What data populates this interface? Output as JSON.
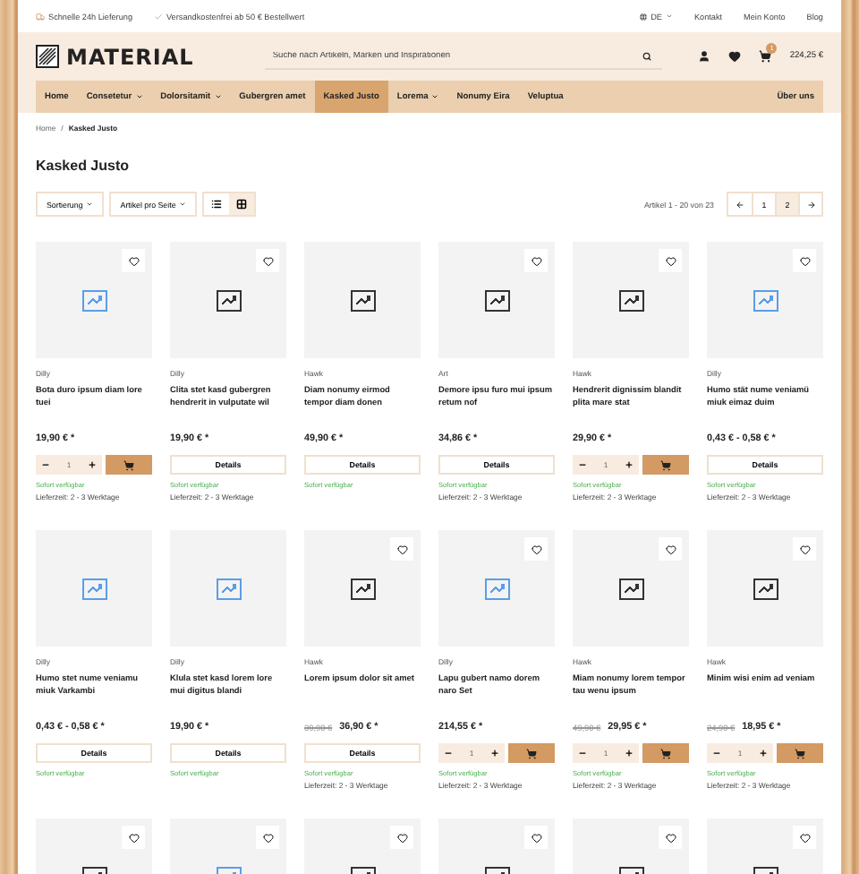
{
  "top_bar": {
    "features": [
      {
        "kind": "truck",
        "text": "Schnelle 24h Lieferung"
      },
      {
        "kind": "check",
        "text": "Versandkostenfrei ab 50 € Bestellwert"
      }
    ],
    "language": "DE",
    "links": [
      "Kontakt",
      "Mein Konto",
      "Blog"
    ]
  },
  "header": {
    "logo": "MATERIAL",
    "search": {
      "placeholder": "Suche nach Artikeln, Marken und Inspirationen"
    },
    "cart": {
      "count": "1",
      "total": "224,25 €"
    }
  },
  "nav": [
    {
      "label": "Home",
      "dropdown": false,
      "selected": false
    },
    {
      "label": "Consetetur",
      "dropdown": true,
      "selected": false
    },
    {
      "label": "Dolorsitamit",
      "dropdown": true,
      "selected": false
    },
    {
      "label": "Gubergren amet",
      "dropdown": false,
      "selected": false
    },
    {
      "label": "Kasked Justo",
      "dropdown": false,
      "selected": true
    },
    {
      "label": "Lorema",
      "dropdown": true,
      "selected": false
    },
    {
      "label": "Nonumy Eira",
      "dropdown": false,
      "selected": false
    },
    {
      "label": "Veluptua",
      "dropdown": false,
      "selected": false
    }
  ],
  "nav_right": "Über uns",
  "breadcrumb": [
    "Home",
    "Kasked Justo"
  ],
  "breadcrumb_separator": "/",
  "title": "Kasked Justo",
  "toolbar": {
    "sort": "Sortierung",
    "per_page": "Artikel pro Seite",
    "views": [
      {
        "kind": "list",
        "selected": false
      },
      {
        "kind": "grid",
        "selected": true
      }
    ],
    "count": "Artikel 1 - 20 von 23",
    "pages": [
      {
        "label": "1",
        "selected": false
      },
      {
        "label": "2",
        "selected": true
      }
    ]
  },
  "products": [
    {
      "color": "#5a9ee8",
      "wishlist": true,
      "brand": "Dilly",
      "name": "Bota duro ipsum diam lore tuei",
      "price": "19,90 € *",
      "kind": "cart",
      "quantity": "1",
      "availability": "Sofort verfügbar",
      "delivery": "Lieferzeit: 2 - 3 Werktage"
    },
    {
      "color": "#333333",
      "wishlist": true,
      "brand": "Dilly",
      "name": "Clita stet kasd gubergren hendrerit in vulputate wil",
      "price": "19,90 € *",
      "kind": "details",
      "button": "Details",
      "availability": "Sofort verfügbar",
      "delivery": "Lieferzeit: 2 - 3 Werktage"
    },
    {
      "color": "#333333",
      "wishlist": false,
      "brand": "Hawk",
      "name": "Diam nonumy eirmod tempor diam donen",
      "price": "49,90 € *",
      "kind": "details",
      "button": "Details",
      "availability": "Sofort verfügbar"
    },
    {
      "color": "#333333",
      "wishlist": true,
      "brand": "Art",
      "name": "Demore ipsu furo mui ipsum retum nof",
      "price": "34,86 € *",
      "kind": "details",
      "button": "Details",
      "availability": "Sofort verfügbar",
      "delivery": "Lieferzeit: 2 - 3 Werktage"
    },
    {
      "color": "#333333",
      "wishlist": true,
      "brand": "Hawk",
      "name": "Hendrerit dignissim blandit plita mare stat",
      "price": "29,90 € *",
      "kind": "cart",
      "quantity": "1",
      "availability": "Sofort verfügbar",
      "delivery": "Lieferzeit: 2 - 3 Werktage"
    },
    {
      "color": "#5a9ee8",
      "wishlist": true,
      "brand": "Dilly",
      "name": "Humo stät nume veniamü miuk eimaz duim",
      "price": "0,43 € - 0,58 € *",
      "kind": "details",
      "button": "Details",
      "availability": "Sofort verfügbar",
      "delivery": "Lieferzeit: 2 - 3 Werktage"
    },
    {
      "color": "#5a9ee8",
      "wishlist": false,
      "brand": "Dilly",
      "name": "Humo stet nume veniamu miuk Varkambi",
      "price": "0,43 € - 0,58 € *",
      "kind": "details",
      "button": "Details",
      "availability": "Sofort verfügbar"
    },
    {
      "color": "#5a9ee8",
      "wishlist": false,
      "brand": "Dilly",
      "name": "Klula stet kasd lorem lore mui digitus blandi",
      "price": "19,90 € *",
      "kind": "details",
      "button": "Details",
      "availability": "Sofort verfügbar"
    },
    {
      "color": "#333333",
      "wishlist": true,
      "brand": "Hawk",
      "name": "Lorem ipsum dolor sit amet",
      "old_price": "39,90 €",
      "price": "36,90 € *",
      "kind": "details",
      "button": "Details",
      "availability": "Sofort verfügbar",
      "delivery": "Lieferzeit: 2 - 3 Werktage"
    },
    {
      "color": "#5a9ee8",
      "wishlist": true,
      "brand": "Dilly",
      "name": "Lapu gubert namo dorem naro Set",
      "price": "214,55 € *",
      "kind": "cart",
      "quantity": "1",
      "availability": "Sofort verfügbar",
      "delivery": "Lieferzeit: 2 - 3 Werktage"
    },
    {
      "color": "#333333",
      "wishlist": true,
      "brand": "Hawk",
      "name": "Miam nonumy lorem tempor tau wenu ipsum",
      "old_price": "49,90 €",
      "price": "29,95 € *",
      "kind": "cart",
      "quantity": "1",
      "availability": "Sofort verfügbar",
      "delivery": "Lieferzeit: 2 - 3 Werktage"
    },
    {
      "color": "#333333",
      "wishlist": true,
      "brand": "Hawk",
      "name": "Minim wisi enim ad veniam",
      "old_price": "24,90 €",
      "price": "18,95 € *",
      "kind": "cart",
      "quantity": "1",
      "availability": "Sofort verfügbar",
      "delivery": "Lieferzeit: 2 - 3 Werktage"
    },
    {
      "color": "#333333",
      "wishlist": true
    },
    {
      "color": "#5a9ee8",
      "wishlist": true
    },
    {
      "color": "#333333",
      "wishlist": true
    },
    {
      "color": "#333333",
      "wishlist": true
    },
    {
      "color": "#333333",
      "wishlist": true
    },
    {
      "color": "#333333",
      "wishlist": true
    }
  ]
}
